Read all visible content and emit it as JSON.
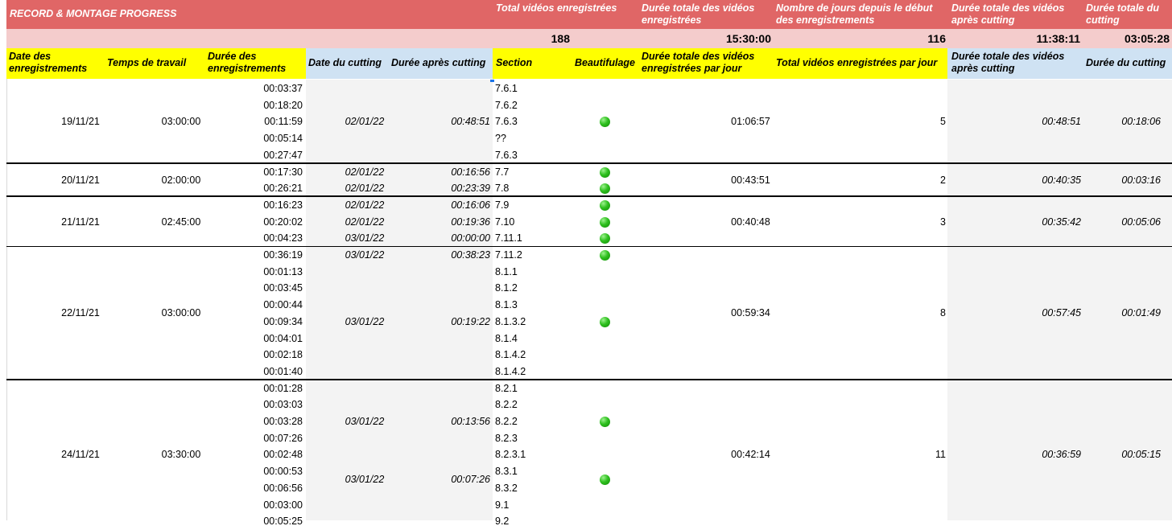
{
  "header": {
    "title": "RECORD & MONTAGE PROGRESS",
    "summary": [
      {
        "label": "Total vidéos enregistrées",
        "value": "188"
      },
      {
        "label": "Durée totale des vidéos enregistrées",
        "value": "15:30:00"
      },
      {
        "label": "Nombre de jours depuis le début des enregistrements",
        "value": "116"
      },
      {
        "label": "Durée totale des vidéos après cutting",
        "value": "11:38:11"
      },
      {
        "label": "Durée totale du cutting",
        "value": "03:05:28"
      }
    ]
  },
  "columns": [
    "Date des enregistrements",
    "Temps de travail",
    "Durée des enregistrements",
    "Date du cutting",
    "Durée après cutting",
    "Section",
    "Beautifulage",
    "Durée totale des vidéos enregistrées par jour",
    "Total vidéos enregistrées par jour",
    "Durée totale des vidéos après cutting",
    "Durée du cutting"
  ],
  "colors": {
    "header_red": "#e06666",
    "header_pink": "#f4cccc",
    "header_yellow": "#ffff00",
    "header_blue": "#cfe2f3",
    "gray_column": "#f3f3f3",
    "status_dot": "#22b814"
  },
  "status_icon": "green-circle-icon",
  "rows": [
    "00:03:37",
    "00:18:20",
    "00:11:59",
    "00:05:14",
    "00:27:47",
    "00:17:30",
    "00:26:21",
    "00:16:23",
    "00:20:02",
    "00:04:23",
    "00:36:19",
    "00:01:13",
    "00:03:45",
    "00:00:44",
    "00:09:34",
    "00:04:01",
    "00:02:18",
    "00:01:40",
    "00:01:28",
    "00:03:03",
    "00:03:28",
    "00:07:26",
    "00:02:48",
    "00:00:53",
    "00:06:56",
    "00:03:00",
    "00:05:25"
  ],
  "sections": [
    "7.6.1",
    "7.6.2",
    "7.6.3",
    "??",
    "7.6.3",
    "7.7",
    "7.8",
    "7.9",
    "7.10",
    "7.11.1",
    "7.11.2",
    "8.1.1",
    "8.1.2",
    "8.1.3",
    "8.1.3.2",
    "8.1.4",
    "8.1.4.2",
    "8.1.4.2",
    "8.2.1",
    "8.2.2",
    "8.2.2",
    "8.2.3",
    "8.2.3.1",
    "8.3.1",
    "8.3.2",
    "9.1",
    "9.2"
  ],
  "cuts": [
    {
      "row": 2,
      "date": "02/01/22",
      "duration": "00:48:51",
      "dot": true
    },
    {
      "row": 5,
      "date": "02/01/22",
      "duration": "00:16:56",
      "dot": true
    },
    {
      "row": 6,
      "date": "02/01/22",
      "duration": "00:23:39",
      "dot": true
    },
    {
      "row": 7,
      "date": "02/01/22",
      "duration": "00:16:06",
      "dot": true
    },
    {
      "row": 8,
      "date": "02/01/22",
      "duration": "00:19:36",
      "dot": true
    },
    {
      "row": 9,
      "date": "03/01/22",
      "duration": "00:00:00",
      "dot": true
    },
    {
      "row": 10,
      "date": "03/01/22",
      "duration": "00:38:23",
      "dot": true
    },
    {
      "row": 14,
      "date": "03/01/22",
      "duration": "00:19:22",
      "dot": true
    },
    {
      "row": 20,
      "date": "03/01/22",
      "duration": "00:13:56",
      "dot": true
    },
    {
      "row": 23.5,
      "date": "03/01/22",
      "duration": "00:07:26",
      "dot": true
    }
  ],
  "groups": [
    {
      "start": 0,
      "end": 5,
      "date": "19/11/21",
      "work": "03:00:00",
      "total_day": "01:06:57",
      "count": "5",
      "after_cut": "00:48:51",
      "cut_time": "00:18:06"
    },
    {
      "start": 5,
      "end": 7,
      "date": "20/11/21",
      "work": "02:00:00",
      "total_day": "00:43:51",
      "count": "2",
      "after_cut": "00:40:35",
      "cut_time": "00:03:16"
    },
    {
      "start": 7,
      "end": 10,
      "date": "21/11/21",
      "work": "02:45:00",
      "total_day": "00:40:48",
      "count": "3",
      "after_cut": "00:35:42",
      "cut_time": "00:05:06"
    },
    {
      "start": 10,
      "end": 18,
      "date": "22/11/21",
      "work": "03:00:00",
      "total_day": "00:59:34",
      "count": "8",
      "after_cut": "00:57:45",
      "cut_time": "00:01:49"
    },
    {
      "start": 18,
      "end": 27,
      "date": "24/11/21",
      "work": "03:30:00",
      "total_day": "00:42:14",
      "count": "11",
      "after_cut": "00:36:59",
      "cut_time": "00:05:15"
    }
  ]
}
